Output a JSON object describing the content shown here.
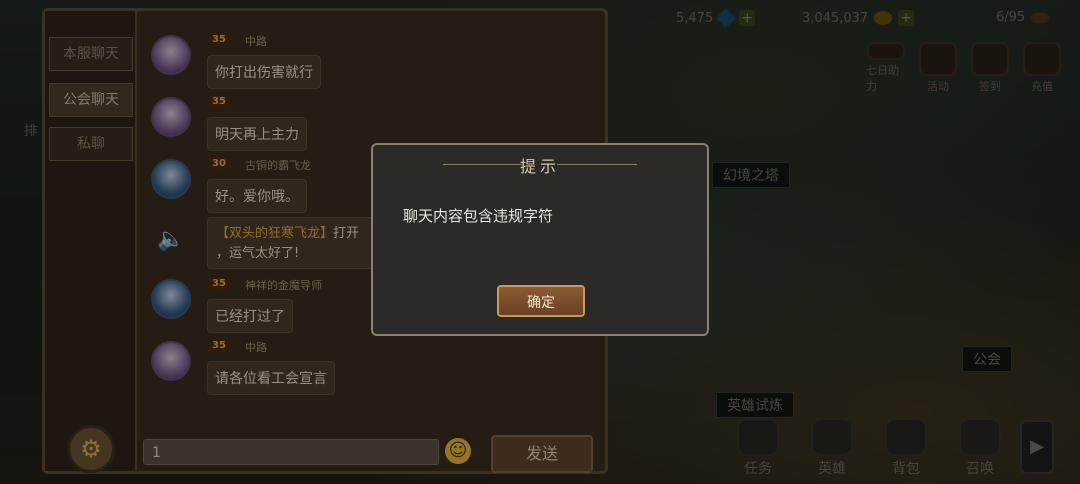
{
  "top": {
    "gems": "5,475",
    "gold": "3,045,037",
    "stamina": "6/95"
  },
  "top_icons": [
    "七日助力",
    "活动",
    "签到",
    "充值"
  ],
  "map": {
    "tower": "幻境之塔",
    "guild": "公会",
    "trial": "英雄试炼",
    "rank": "排"
  },
  "bottom_nav": [
    "任务",
    "英雄",
    "背包",
    "召唤"
  ],
  "chat": {
    "tabs": [
      "本服聊天",
      "公会聊天",
      "私聊"
    ],
    "messages": [
      {
        "level": "35",
        "name": "中路",
        "text": "你打出伤害就行"
      },
      {
        "level": "35",
        "name": "",
        "text": "明天再上主力"
      },
      {
        "level": "30",
        "name": "古铜的霸飞龙",
        "text": "好。爱你哦。"
      },
      {
        "level": "35",
        "name": "神祥的金魔导师",
        "text": "已经打过了"
      },
      {
        "level": "35",
        "name": "中路",
        "text": "请各位看工会宣言"
      }
    ],
    "system": {
      "highlight": "【双头的狂寒飞龙】",
      "text_a": "打开",
      "text_b": "，运气太好了!"
    },
    "input_value": "1",
    "send_label": "发送"
  },
  "dialog": {
    "title": "提示",
    "message": "聊天内容包含违规字符",
    "ok_label": "确定"
  }
}
